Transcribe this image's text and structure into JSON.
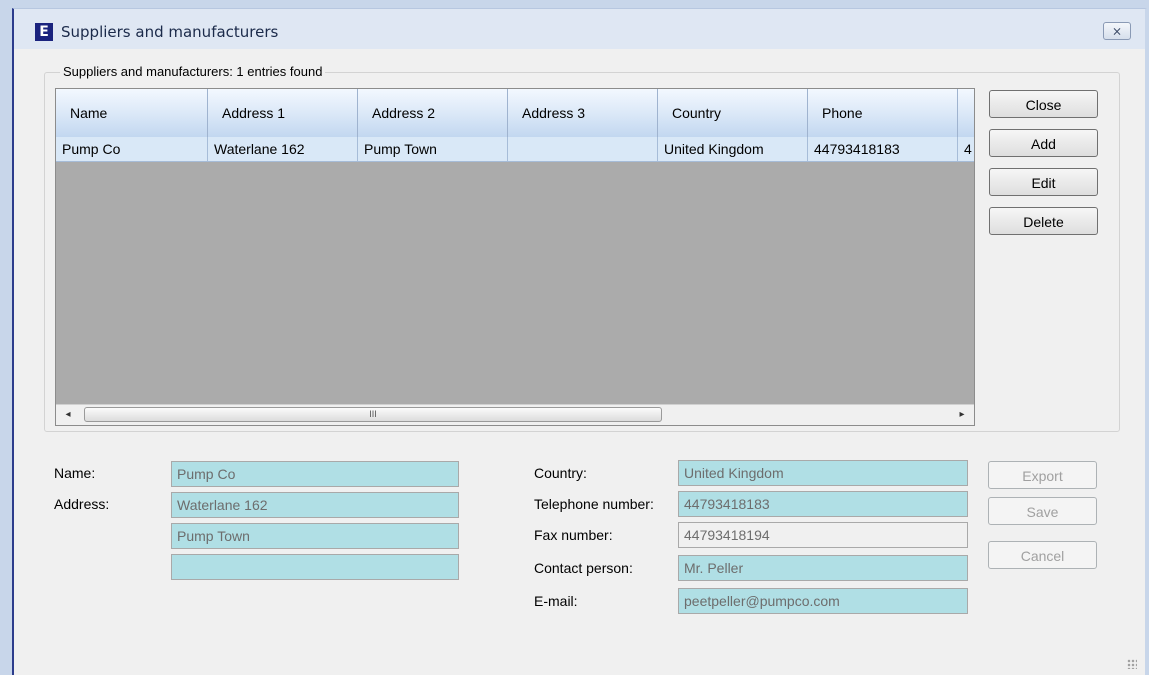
{
  "window": {
    "title": "Suppliers and manufacturers",
    "icon_letter": "E",
    "close_glyph": "⨯"
  },
  "group": {
    "legend": "Suppliers and manufacturers: 1 entries found"
  },
  "grid": {
    "columns": [
      "Name",
      "Address 1",
      "Address 2",
      "Address 3",
      "Country",
      "Phone",
      ""
    ],
    "rows": [
      [
        "Pump Co",
        "Waterlane 162",
        "Pump Town",
        "",
        "United Kingdom",
        "44793418183",
        "4"
      ]
    ],
    "scroll_left": "◂",
    "scroll_right": "▸",
    "scroll_grip": "III"
  },
  "side_buttons": {
    "close": "Close",
    "add": "Add",
    "edit": "Edit",
    "delete": "Delete"
  },
  "form": {
    "name_label": "Name:",
    "address_label": "Address:",
    "country_label": "Country:",
    "phone_label": "Telephone number:",
    "fax_label": "Fax number:",
    "contact_label": "Contact person:",
    "email_label": "E-mail:",
    "name": "Pump Co",
    "address1": "Waterlane 162",
    "address2": "Pump Town",
    "address3": "",
    "country": "United Kingdom",
    "phone": "44793418183",
    "fax": "44793418194",
    "contact": "Mr. Peller",
    "email": "peetpeller@pumpco.com"
  },
  "action_buttons": {
    "export": "Export",
    "save": "Save",
    "cancel": "Cancel"
  },
  "colors": {
    "field_fill": "#b0dfe5",
    "grid_background": "#ababab",
    "selected_row": "#d9e8f7"
  }
}
